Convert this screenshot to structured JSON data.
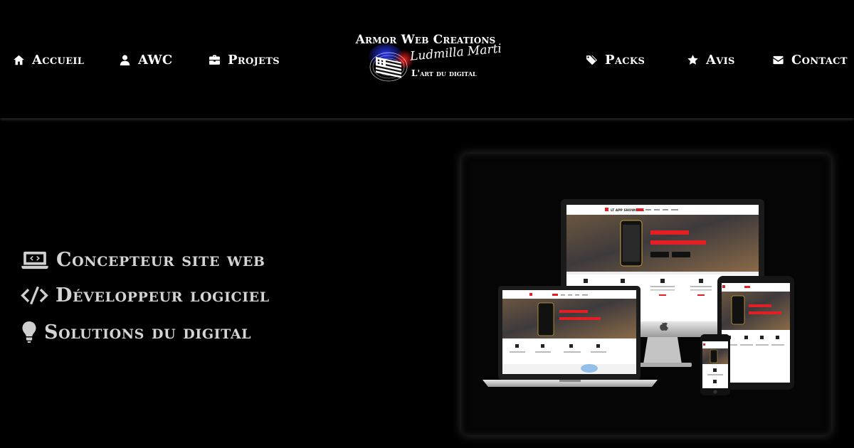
{
  "nav": {
    "left": [
      {
        "label": "Accueil",
        "icon": "home-icon"
      },
      {
        "label": "AWC",
        "icon": "user-icon"
      },
      {
        "label": "Projets",
        "icon": "briefcase-icon"
      }
    ],
    "right": [
      {
        "label": "Packs",
        "icon": "tags-icon"
      },
      {
        "label": "Avis",
        "icon": "star-icon"
      },
      {
        "label": "Contact",
        "icon": "envelope-icon"
      }
    ]
  },
  "logo": {
    "title": "Armor Web Creations",
    "signature": "Ludmilla Marti",
    "tagline": "L'art du digital"
  },
  "hero": {
    "lines": [
      {
        "label": "Concepteur site web",
        "icon": "laptop-code-icon"
      },
      {
        "label": "Développeur logiciel",
        "icon": "code-icon"
      },
      {
        "label": "Solutions du digital",
        "icon": "lightbulb-icon"
      }
    ]
  },
  "showcase": {
    "brand": "LT APP SHOWCASE",
    "features": [
      "iOS Apps",
      "Android Apps",
      "Windows Phone Apps",
      "Other Apps"
    ],
    "badges": [
      "COMPATIBLE WITH MOBILE",
      "OUR DESIGN BUILD WITH MOBILE LAYOUT"
    ]
  },
  "colors": {
    "background": "#000000",
    "text": "#ffffff",
    "hero_text": "#d4d4d4",
    "accent": "#e31e24"
  }
}
